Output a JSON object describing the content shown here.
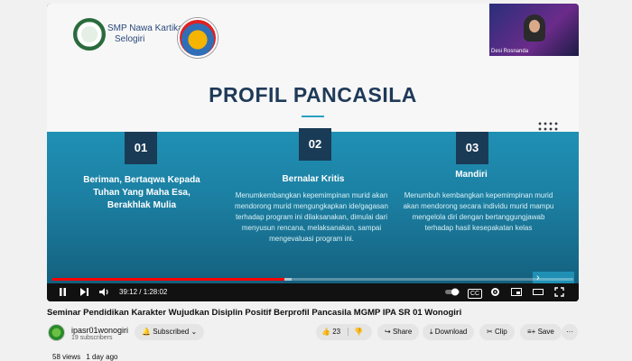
{
  "slide": {
    "school_name_line1": "SMP Nawa Kartika",
    "school_name_line2": "Selogiri",
    "title": "PROFIL PANCASILA",
    "columns": [
      {
        "num": "01",
        "heading": "Beriman, Bertaqwa Kepada Tuhan Yang Maha Esa, Berakhlak Mulia",
        "body": ""
      },
      {
        "num": "02",
        "heading": "Bernalar Kritis",
        "body": "Menumkembangkan kepemimpinan murid akan mendorong murid mengungkapkan ide/gagasan terhadap program ini dilaksanakan, dimulai dari menyusun rencana, melaksanakan, sampai mengevaluasi program ini."
      },
      {
        "num": "03",
        "heading": "Mandiri",
        "body": "Menumbuh kembangkan kepemimpinan murid akan mendorong secara individu murid mampu mengelola diri dengan bertanggungjawab terhadap hasil kesepakatan kelas"
      }
    ]
  },
  "webcam": {
    "name": "Desi Rosnanda"
  },
  "player": {
    "time": "39:12 / 1:28:02",
    "progress_fraction": 0.445,
    "buffer_fraction": 0.46,
    "cc_label": "CC"
  },
  "video": {
    "title": "Seminar Pendidikan Karakter Wujudkan Disiplin Positif Berprofil Pancasila MGMP IPA SR 01 Wonogiri",
    "channel": "ipasr01wonogiri",
    "subscribers": "19 subscribers",
    "subscribed_label": "Subscribed",
    "likes": "23",
    "share_label": "Share",
    "download_label": "Download",
    "clip_label": "Clip",
    "save_label": "Save",
    "views": "58 views",
    "age": "1 day ago",
    "more_label": "···"
  }
}
